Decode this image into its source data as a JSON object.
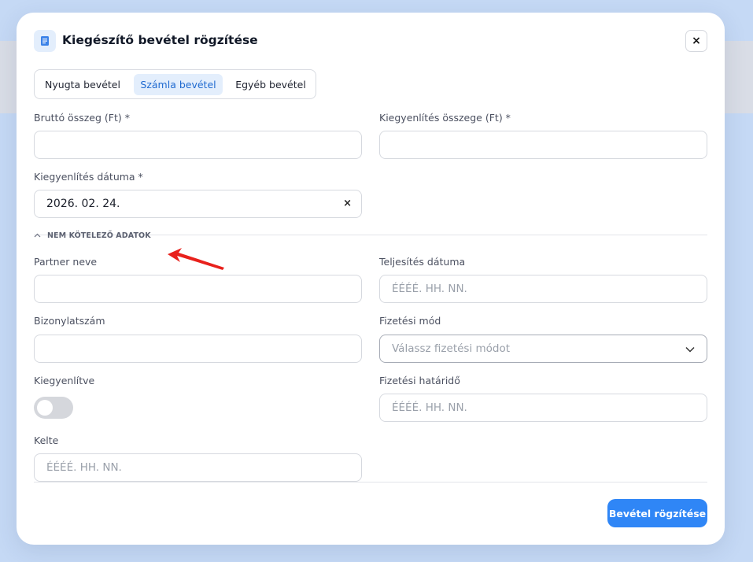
{
  "modal": {
    "title": "Kiegészítő bevétel rögzítése",
    "close_label": "×"
  },
  "tabs": [
    {
      "label": "Nyugta bevétel",
      "active": false
    },
    {
      "label": "Számla bevétel",
      "active": true
    },
    {
      "label": "Egyéb bevétel",
      "active": false
    }
  ],
  "required": {
    "gross_amount": {
      "label": "Bruttó összeg (Ft) *",
      "value": ""
    },
    "settlement_amount": {
      "label": "Kiegyenlítés összege (Ft) *",
      "value": ""
    },
    "settlement_date": {
      "label": "Kiegyenlítés dátuma *",
      "value": "2026. 02. 24.",
      "clear_label": "×"
    }
  },
  "optional_section": {
    "toggle_label": "NEM KÖTELEZŐ ADATOK",
    "partner_name": {
      "label": "Partner neve",
      "value": ""
    },
    "completion_date": {
      "label": "Teljesítés dátuma",
      "placeholder": "ÉÉÉÉ. HH. NN."
    },
    "document_number": {
      "label": "Bizonylatszám",
      "value": ""
    },
    "payment_method": {
      "label": "Fizetési mód",
      "placeholder": "Válassz fizetési módot"
    },
    "settled": {
      "label": "Kiegyenlítve",
      "checked": false
    },
    "payment_deadline": {
      "label": "Fizetési határidő",
      "placeholder": "ÉÉÉÉ. HH. NN."
    },
    "issue_date": {
      "label": "Kelte",
      "placeholder": "ÉÉÉÉ. HH. NN."
    }
  },
  "footer": {
    "submit_label": "Bevétel rögzítése"
  },
  "colors": {
    "accent": "#2f86f6",
    "active_tab_bg": "#e3eefc",
    "annotation_arrow": "#e8211c"
  },
  "icons": {
    "modal_icon": "document-icon",
    "collapse": "chevron-up-icon",
    "select": "chevron-down-icon"
  }
}
